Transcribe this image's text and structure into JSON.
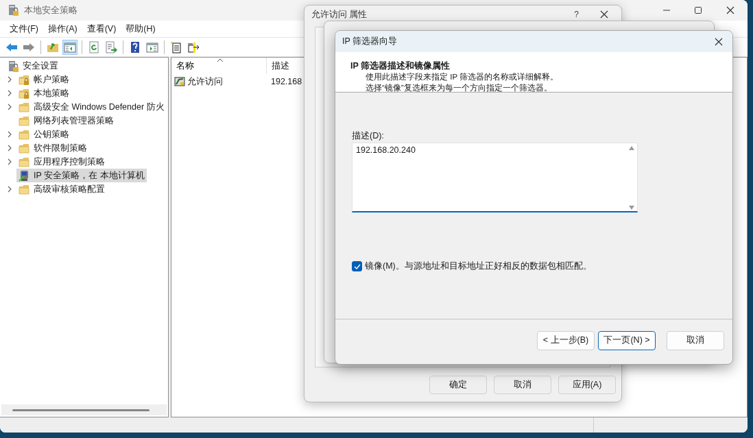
{
  "main_window": {
    "title": "本地安全策略",
    "menu": [
      "文件(F)",
      "操作(A)",
      "查看(V)",
      "帮助(H)"
    ],
    "toolbar": [
      {
        "kind": "back",
        "pressed": false
      },
      {
        "kind": "forward",
        "pressed": false
      },
      {
        "kind": "sep"
      },
      {
        "kind": "up",
        "pressed": false
      },
      {
        "kind": "tree",
        "pressed": true
      },
      {
        "kind": "sep"
      },
      {
        "kind": "refresh",
        "pressed": false
      },
      {
        "kind": "export",
        "pressed": false
      },
      {
        "kind": "sep"
      },
      {
        "kind": "help",
        "pressed": false
      },
      {
        "kind": "panel",
        "pressed": false
      },
      {
        "kind": "sep"
      },
      {
        "kind": "new",
        "pressed": false
      },
      {
        "kind": "action",
        "pressed": false
      }
    ],
    "tree": {
      "label": "安全设置",
      "kind": "server",
      "selected": false,
      "children": [
        {
          "label": "帐户策略",
          "kind": "lockfolder",
          "expandable": true,
          "selected": false
        },
        {
          "label": "本地策略",
          "kind": "lockfolder",
          "expandable": true,
          "selected": false
        },
        {
          "label": "高级安全 Windows Defender 防火",
          "kind": "folder",
          "expandable": true,
          "selected": false
        },
        {
          "label": "网络列表管理器策略",
          "kind": "folder",
          "expandable": false,
          "selected": false
        },
        {
          "label": "公钥策略",
          "kind": "folder",
          "expandable": true,
          "selected": false
        },
        {
          "label": "软件限制策略",
          "kind": "folder",
          "expandable": true,
          "selected": false
        },
        {
          "label": "应用程序控制策略",
          "kind": "folder",
          "expandable": true,
          "selected": false
        },
        {
          "label": "IP 安全策略，在 本地计算机",
          "kind": "ipsec",
          "expandable": false,
          "selected": true
        },
        {
          "label": "高级审核策略配置",
          "kind": "folder",
          "expandable": true,
          "selected": false
        }
      ]
    },
    "list": {
      "columns": [
        {
          "label": "名称",
          "sorted": true
        },
        {
          "label": "描述",
          "sorted": false
        }
      ],
      "rows": [
        {
          "name": "允许访问",
          "description": "192.168"
        }
      ]
    }
  },
  "properties_dialog": {
    "title": "允许访问 属性",
    "help": "?",
    "buttons": [
      "确定",
      "取消",
      "应用(A)"
    ]
  },
  "wizard": {
    "title": "IP 筛选器向导",
    "heading": "IP 筛选器描述和镜像属性",
    "subtitle_lines": [
      "使用此描述字段来指定 IP 筛选器的名称或详细解释。",
      "选择“镜像”复选框来为每一个方向指定一个筛选器。"
    ],
    "description_label": "描述(D):",
    "description_value": "192.168.20.240",
    "mirror": {
      "label": "镜像(M)。与源地址和目标地址正好相反的数据包相匹配。",
      "checked": true
    },
    "buttons": [
      {
        "label": "< 上一步(B)",
        "default": false
      },
      {
        "label": "下一页(N) >",
        "default": true
      },
      {
        "label": "取消",
        "default": false
      }
    ]
  }
}
